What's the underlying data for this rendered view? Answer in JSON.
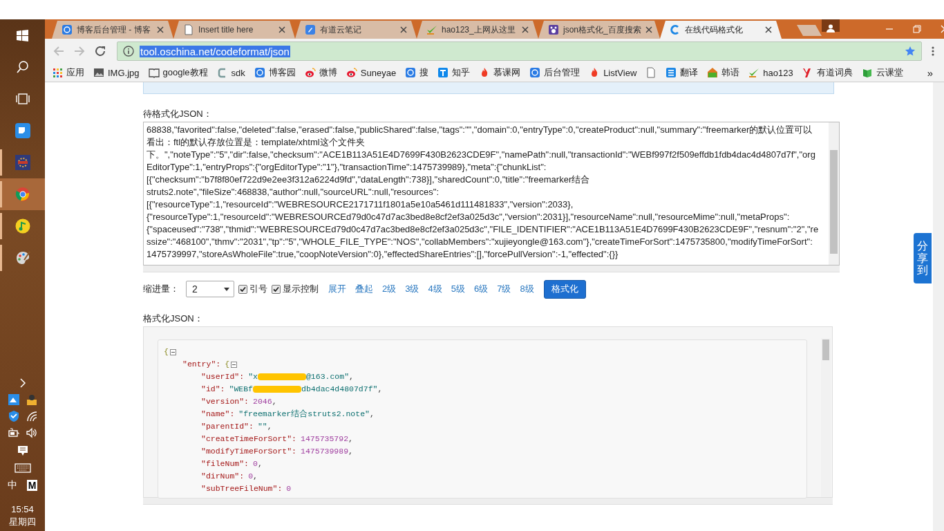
{
  "taskbar": {
    "apps": [
      {
        "kind": "windows",
        "running": false,
        "active": false
      },
      {
        "kind": "search",
        "running": false,
        "active": false
      },
      {
        "kind": "taskview",
        "running": false,
        "active": false
      },
      {
        "kind": "chat",
        "running": false,
        "active": false
      },
      {
        "kind": "ide",
        "running": true,
        "active": false
      },
      {
        "kind": "chrome",
        "running": true,
        "active": true
      },
      {
        "kind": "music",
        "running": true,
        "active": false
      },
      {
        "kind": "paint",
        "running": true,
        "active": false
      }
    ],
    "tray": {
      "ime": "中",
      "ime_mode": "M",
      "time": "15:54",
      "day": "星期四"
    }
  },
  "browser": {
    "tabs": [
      {
        "kind": "cnblogs",
        "title": "博客后台管理 - 博客",
        "selected": false
      },
      {
        "kind": "page",
        "title": "Insert title here",
        "selected": false
      },
      {
        "kind": "note",
        "title": "有道云笔记",
        "selected": false
      },
      {
        "kind": "hao",
        "title": "hao123_上网从这里",
        "selected": false
      },
      {
        "kind": "paw",
        "title": "json格式化_百度搜索",
        "selected": false
      },
      {
        "kind": "oschina",
        "title": "在线代码格式化",
        "selected": true
      }
    ],
    "address": "tool.oschina.net/codeformat/json",
    "bookmarks": [
      {
        "kind": "grid",
        "label": "应用"
      },
      {
        "kind": "image",
        "label": "IMG.jpg"
      },
      {
        "kind": "book",
        "label": "google教程"
      },
      {
        "kind": "arc",
        "label": "sdk"
      },
      {
        "kind": "cnblogs",
        "label": "博客园"
      },
      {
        "kind": "weibo",
        "label": "微博"
      },
      {
        "kind": "weibo",
        "label": "Suneyae"
      },
      {
        "kind": "cnblogs",
        "label": "搜"
      },
      {
        "kind": "zhihu",
        "label": "知乎"
      },
      {
        "kind": "flame",
        "label": "慕课网"
      },
      {
        "kind": "cnblogs",
        "label": "后台管理"
      },
      {
        "kind": "flame",
        "label": "ListView"
      },
      {
        "kind": "page"
      },
      {
        "kind": "translate",
        "label": "翻译"
      },
      {
        "kind": "korean",
        "label": "韩语"
      },
      {
        "kind": "hao",
        "label": "hao123"
      },
      {
        "kind": "youdao",
        "label": "有道词典"
      },
      {
        "kind": "cloud",
        "label": "云课堂"
      }
    ],
    "bookmarks_overflow": "»"
  },
  "page": {
    "input_label": "待格式化JSON：",
    "input_lines": [
      "68838,\"favorited\":false,\"deleted\":false,\"erased\":false,\"publicShared\":false,\"tags\":\"\",\"domain\":0,\"entryType\":0,\"createProduct\":null,\"summary\":\"freemarker的默认位置可以",
      "看出：ftl的默认存放位置是：template/xhtml这个文件夹",
      "下。\",\"noteType\":\"5\",\"dir\":false,\"checksum\":\"ACE1B113A51E4D7699F430B2623CDE9F\",\"namePath\":null,\"transactionId\":\"WEBf997f2f509effdb1fdb4dac4d4807d7f\",\"org",
      "EditorType\":1,\"entryProps\":{\"orgEditorType\":\"1\"},\"transactionTime\":1475739989},\"meta\":{\"chunkList\":",
      "[{\"checksum\":\"b7f8f80ef722d9e2ee3f312a6224d9fd\",\"dataLength\":738}],\"sharedCount\":0,\"title\":\"freemarker结合",
      "struts2.note\",\"fileSize\":468838,\"author\":null,\"sourceURL\":null,\"resources\":",
      "[{\"resourceType\":1,\"resourceId\":\"WEBRESOURCE2171711f1801a5e10a5461d111481833\",\"version\":2033},",
      "{\"resourceType\":1,\"resourceId\":\"WEBRESOURCEd79d0c47d7ac3bed8e8cf2ef3a025d3c\",\"version\":2031}],\"resourceName\":null,\"resourceMime\":null,\"metaProps\":",
      "{\"spaceused\":\"738\",\"thmid\":\"WEBRESOURCEd79d0c47d7ac3bed8e8cf2ef3a025d3c\",\"FILE_IDENTIFIER\":\"ACE1B113A51E4D7699F430B2623CDE9F\",\"resnum\":\"2\",\"re",
      "ssize\":\"468100\",\"thmv\":\"2031\",\"tp\":\"5\",\"WHOLE_FILE_TYPE\":\"NOS\",\"collabMembers\":\"xujieyongle@163.com\"},\"createTimeForSort\":1475735800,\"modifyTimeForSort\":",
      "1475739997,\"storeAsWholeFile\":true,\"coopNoteVersion\":0},\"effectedShareEntries\":[],\"forcePullVersion\":-1,\"effected\":{}}"
    ],
    "indent_label": "缩进量：",
    "indent_value": "2",
    "options": [
      {
        "label": "引号",
        "checked": true
      },
      {
        "label": "显示控制",
        "checked": true
      }
    ],
    "links": [
      "展开",
      "叠起",
      "2级",
      "3级",
      "4级",
      "5级",
      "6级",
      "7级",
      "8级"
    ],
    "format_button": "格式化",
    "output_label": "格式化JSON：",
    "output": {
      "open": "{",
      "collapsed": false,
      "children": [
        {
          "key": "\"entry\":",
          "open": "{",
          "collapsed": false,
          "children": [
            {
              "key": "\"userId\":",
              "kind": "string",
              "value": "\"x",
              "redacted": true,
              "value_rest": "@163.com\"",
              "sep": ","
            },
            {
              "key": "\"id\":",
              "kind": "string",
              "value": "\"WEBf",
              "redacted": true,
              "value_rest": "db4dac4d4807d7f\"",
              "sep": ","
            },
            {
              "key": "\"version\":",
              "kind": "number",
              "value": "2046",
              "sep": ","
            },
            {
              "key": "\"name\":",
              "kind": "string",
              "value": "\"freemarker结合struts2.note\"",
              "sep": ","
            },
            {
              "key": "\"parentId\":",
              "kind": "string",
              "value": "\"\"",
              "sep": ","
            },
            {
              "key": "\"createTimeForSort\":",
              "kind": "number",
              "value": "1475735792",
              "sep": ","
            },
            {
              "key": "\"modifyTimeForSort\":",
              "kind": "number",
              "value": "1475739989",
              "sep": ","
            },
            {
              "key": "\"fileNum\":",
              "kind": "number",
              "value": "0",
              "sep": ","
            },
            {
              "key": "\"dirNum\":",
              "kind": "number",
              "value": "0",
              "sep": ","
            },
            {
              "key": "\"subTreeFileNum\":",
              "kind": "number",
              "value": "0"
            }
          ]
        }
      ]
    },
    "share_tab": "分享到"
  }
}
